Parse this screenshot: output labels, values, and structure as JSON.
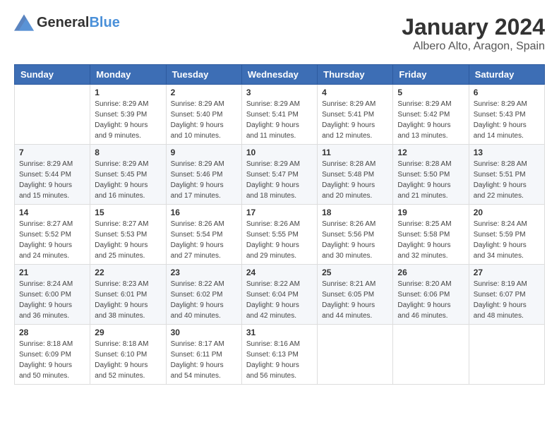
{
  "logo": {
    "text_general": "General",
    "text_blue": "Blue"
  },
  "title": "January 2024",
  "location": "Albero Alto, Aragon, Spain",
  "weekdays": [
    "Sunday",
    "Monday",
    "Tuesday",
    "Wednesday",
    "Thursday",
    "Friday",
    "Saturday"
  ],
  "weeks": [
    [
      {
        "day": "",
        "sunrise": "",
        "sunset": "",
        "daylight": ""
      },
      {
        "day": "1",
        "sunrise": "Sunrise: 8:29 AM",
        "sunset": "Sunset: 5:39 PM",
        "daylight": "Daylight: 9 hours and 9 minutes."
      },
      {
        "day": "2",
        "sunrise": "Sunrise: 8:29 AM",
        "sunset": "Sunset: 5:40 PM",
        "daylight": "Daylight: 9 hours and 10 minutes."
      },
      {
        "day": "3",
        "sunrise": "Sunrise: 8:29 AM",
        "sunset": "Sunset: 5:41 PM",
        "daylight": "Daylight: 9 hours and 11 minutes."
      },
      {
        "day": "4",
        "sunrise": "Sunrise: 8:29 AM",
        "sunset": "Sunset: 5:41 PM",
        "daylight": "Daylight: 9 hours and 12 minutes."
      },
      {
        "day": "5",
        "sunrise": "Sunrise: 8:29 AM",
        "sunset": "Sunset: 5:42 PM",
        "daylight": "Daylight: 9 hours and 13 minutes."
      },
      {
        "day": "6",
        "sunrise": "Sunrise: 8:29 AM",
        "sunset": "Sunset: 5:43 PM",
        "daylight": "Daylight: 9 hours and 14 minutes."
      }
    ],
    [
      {
        "day": "7",
        "sunrise": "Sunrise: 8:29 AM",
        "sunset": "Sunset: 5:44 PM",
        "daylight": "Daylight: 9 hours and 15 minutes."
      },
      {
        "day": "8",
        "sunrise": "Sunrise: 8:29 AM",
        "sunset": "Sunset: 5:45 PM",
        "daylight": "Daylight: 9 hours and 16 minutes."
      },
      {
        "day": "9",
        "sunrise": "Sunrise: 8:29 AM",
        "sunset": "Sunset: 5:46 PM",
        "daylight": "Daylight: 9 hours and 17 minutes."
      },
      {
        "day": "10",
        "sunrise": "Sunrise: 8:29 AM",
        "sunset": "Sunset: 5:47 PM",
        "daylight": "Daylight: 9 hours and 18 minutes."
      },
      {
        "day": "11",
        "sunrise": "Sunrise: 8:28 AM",
        "sunset": "Sunset: 5:48 PM",
        "daylight": "Daylight: 9 hours and 20 minutes."
      },
      {
        "day": "12",
        "sunrise": "Sunrise: 8:28 AM",
        "sunset": "Sunset: 5:50 PM",
        "daylight": "Daylight: 9 hours and 21 minutes."
      },
      {
        "day": "13",
        "sunrise": "Sunrise: 8:28 AM",
        "sunset": "Sunset: 5:51 PM",
        "daylight": "Daylight: 9 hours and 22 minutes."
      }
    ],
    [
      {
        "day": "14",
        "sunrise": "Sunrise: 8:27 AM",
        "sunset": "Sunset: 5:52 PM",
        "daylight": "Daylight: 9 hours and 24 minutes."
      },
      {
        "day": "15",
        "sunrise": "Sunrise: 8:27 AM",
        "sunset": "Sunset: 5:53 PM",
        "daylight": "Daylight: 9 hours and 25 minutes."
      },
      {
        "day": "16",
        "sunrise": "Sunrise: 8:26 AM",
        "sunset": "Sunset: 5:54 PM",
        "daylight": "Daylight: 9 hours and 27 minutes."
      },
      {
        "day": "17",
        "sunrise": "Sunrise: 8:26 AM",
        "sunset": "Sunset: 5:55 PM",
        "daylight": "Daylight: 9 hours and 29 minutes."
      },
      {
        "day": "18",
        "sunrise": "Sunrise: 8:26 AM",
        "sunset": "Sunset: 5:56 PM",
        "daylight": "Daylight: 9 hours and 30 minutes."
      },
      {
        "day": "19",
        "sunrise": "Sunrise: 8:25 AM",
        "sunset": "Sunset: 5:58 PM",
        "daylight": "Daylight: 9 hours and 32 minutes."
      },
      {
        "day": "20",
        "sunrise": "Sunrise: 8:24 AM",
        "sunset": "Sunset: 5:59 PM",
        "daylight": "Daylight: 9 hours and 34 minutes."
      }
    ],
    [
      {
        "day": "21",
        "sunrise": "Sunrise: 8:24 AM",
        "sunset": "Sunset: 6:00 PM",
        "daylight": "Daylight: 9 hours and 36 minutes."
      },
      {
        "day": "22",
        "sunrise": "Sunrise: 8:23 AM",
        "sunset": "Sunset: 6:01 PM",
        "daylight": "Daylight: 9 hours and 38 minutes."
      },
      {
        "day": "23",
        "sunrise": "Sunrise: 8:22 AM",
        "sunset": "Sunset: 6:02 PM",
        "daylight": "Daylight: 9 hours and 40 minutes."
      },
      {
        "day": "24",
        "sunrise": "Sunrise: 8:22 AM",
        "sunset": "Sunset: 6:04 PM",
        "daylight": "Daylight: 9 hours and 42 minutes."
      },
      {
        "day": "25",
        "sunrise": "Sunrise: 8:21 AM",
        "sunset": "Sunset: 6:05 PM",
        "daylight": "Daylight: 9 hours and 44 minutes."
      },
      {
        "day": "26",
        "sunrise": "Sunrise: 8:20 AM",
        "sunset": "Sunset: 6:06 PM",
        "daylight": "Daylight: 9 hours and 46 minutes."
      },
      {
        "day": "27",
        "sunrise": "Sunrise: 8:19 AM",
        "sunset": "Sunset: 6:07 PM",
        "daylight": "Daylight: 9 hours and 48 minutes."
      }
    ],
    [
      {
        "day": "28",
        "sunrise": "Sunrise: 8:18 AM",
        "sunset": "Sunset: 6:09 PM",
        "daylight": "Daylight: 9 hours and 50 minutes."
      },
      {
        "day": "29",
        "sunrise": "Sunrise: 8:18 AM",
        "sunset": "Sunset: 6:10 PM",
        "daylight": "Daylight: 9 hours and 52 minutes."
      },
      {
        "day": "30",
        "sunrise": "Sunrise: 8:17 AM",
        "sunset": "Sunset: 6:11 PM",
        "daylight": "Daylight: 9 hours and 54 minutes."
      },
      {
        "day": "31",
        "sunrise": "Sunrise: 8:16 AM",
        "sunset": "Sunset: 6:13 PM",
        "daylight": "Daylight: 9 hours and 56 minutes."
      },
      {
        "day": "",
        "sunrise": "",
        "sunset": "",
        "daylight": ""
      },
      {
        "day": "",
        "sunrise": "",
        "sunset": "",
        "daylight": ""
      },
      {
        "day": "",
        "sunrise": "",
        "sunset": "",
        "daylight": ""
      }
    ]
  ]
}
